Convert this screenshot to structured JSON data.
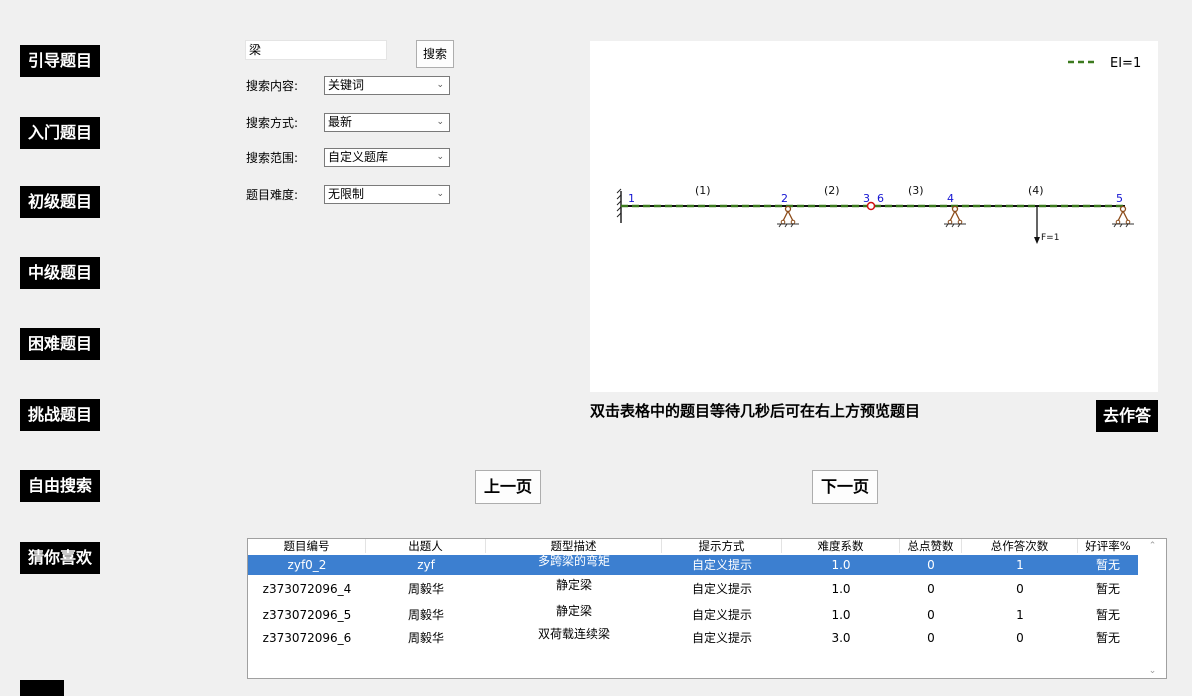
{
  "nav": {
    "items": [
      "引导题目",
      "入门题目",
      "初级题目",
      "中级题目",
      "困难题目",
      "挑战题目",
      "自由搜索",
      "猜你喜欢"
    ]
  },
  "search": {
    "value": "梁",
    "button": "搜索",
    "filters": [
      {
        "label": "搜索内容:",
        "value": "关键词"
      },
      {
        "label": "搜索方式:",
        "value": "最新"
      },
      {
        "label": "搜索范围:",
        "value": "自定义题库"
      },
      {
        "label": "题目难度:",
        "value": "无限制"
      }
    ]
  },
  "preview": {
    "legend": "EI=1",
    "node_labels": [
      "1",
      "2",
      "3",
      "6",
      "4",
      "5"
    ],
    "element_labels": [
      "(1)",
      "(2)",
      "(3)",
      "(4)"
    ],
    "load_label": "F=1",
    "colors": {
      "beam": "#3c7a1e",
      "node_label": "#1414d2",
      "support": "#8c4c1a",
      "hinge": "#d01010"
    }
  },
  "hint": "双击表格中的题目等待几秒后可在右上方预览题目",
  "go_answer": "去作答",
  "pagination": {
    "prev": "上一页",
    "next": "下一页"
  },
  "table": {
    "columns": [
      "题目编号",
      "出题人",
      "题型描述",
      "提示方式",
      "难度系数",
      "总点赞数",
      "总作答次数",
      "好评率%"
    ],
    "rows": [
      [
        "zyf0_2",
        "zyf",
        "多跨梁的弯矩",
        "自定义提示",
        "1.0",
        "0",
        "1",
        "暂无"
      ],
      [
        "z373072096_4",
        "周毅华",
        "静定梁",
        "自定义提示",
        "1.0",
        "0",
        "0",
        "暂无"
      ],
      [
        "z373072096_5",
        "周毅华",
        "静定梁",
        "自定义提示",
        "1.0",
        "0",
        "1",
        "暂无"
      ],
      [
        "z373072096_6",
        "周毅华",
        "双荷载连续梁",
        "自定义提示",
        "3.0",
        "0",
        "0",
        "暂无"
      ]
    ],
    "selected_row": 0,
    "selection_color": "#3c7fd0"
  }
}
